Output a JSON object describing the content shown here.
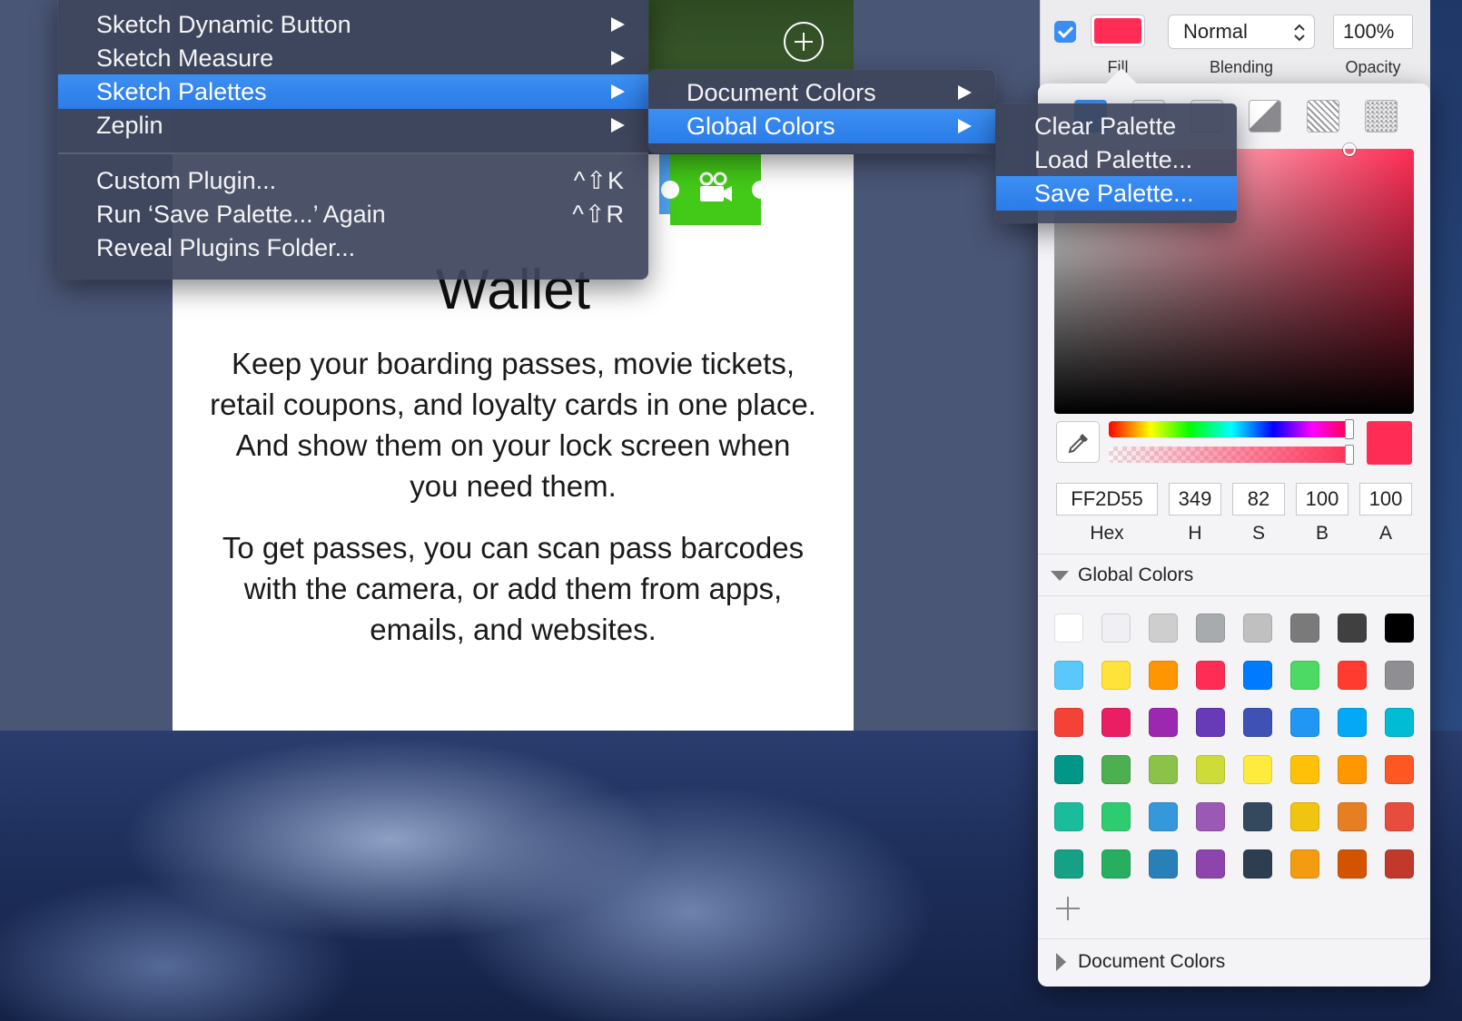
{
  "plugins_menu": {
    "items": [
      {
        "label": "Sketch Dynamic Button",
        "submenu": true
      },
      {
        "label": "Sketch Measure",
        "submenu": true
      },
      {
        "label": "Sketch Palettes",
        "submenu": true,
        "selected": true
      },
      {
        "label": "Zeplin",
        "submenu": true
      }
    ],
    "actions": [
      {
        "label": "Custom Plugin...",
        "shortcut": "^⇧K"
      },
      {
        "label": "Run ‘Save Palette...’ Again",
        "shortcut": "^⇧R"
      },
      {
        "label": "Reveal Plugins Folder...",
        "shortcut": ""
      }
    ]
  },
  "palettes_menu": {
    "items": [
      {
        "label": "Document Colors",
        "submenu": true
      },
      {
        "label": "Global Colors",
        "submenu": true,
        "selected": true
      }
    ]
  },
  "global_colors_menu": {
    "items": [
      {
        "label": "Clear Palette"
      },
      {
        "label": "Load Palette..."
      },
      {
        "label": "Save Palette...",
        "selected": true
      }
    ]
  },
  "artboard": {
    "title": "Wallet",
    "paragraph_1": "Keep your boarding passes, movie tickets, retail coupons, and loyalty cards in one place. And show them on your lock screen when you need them.",
    "paragraph_2": "To get passes, you can scan pass barcodes with the camera, or add them from apps, emails, and websites.",
    "icons": [
      "add-circle-icon",
      "movie-camera-icon"
    ],
    "tile_color": "#43c918"
  },
  "inspector": {
    "fill_label": "Fill",
    "fill_enabled": true,
    "blending_value": "Normal",
    "blending_label": "Blending",
    "opacity_value": "100%",
    "opacity_label": "Opacity"
  },
  "color_picker": {
    "current_color": "#ff2d55",
    "hex_value": "FF2D55",
    "h_value": "349",
    "s_value": "82",
    "b_value": "100",
    "a_value": "100",
    "hex_label": "Hex",
    "h_label": "H",
    "s_label": "S",
    "b_label": "B",
    "a_label": "A",
    "fill_types": [
      "solid-fill-icon",
      "linear-gradient-icon",
      "radial-gradient-icon",
      "angular-gradient-icon",
      "pattern-fill-icon",
      "noise-fill-icon"
    ],
    "global_colors_title": "Global Colors",
    "document_colors_title": "Document Colors",
    "swatches": [
      [
        "#ffffff",
        "#efeff4",
        "#cecece",
        "#a8abad",
        "#c0c0c0",
        "#7a7a7a",
        "#404040",
        "#000000"
      ],
      [
        "#5ac8fa",
        "#ffe23a",
        "#ff9500",
        "#ff2d55",
        "#007aff",
        "#4cd964",
        "#ff3b30",
        "#8e8e93"
      ],
      [
        "#f44336",
        "#e91e63",
        "#9c27b0",
        "#673ab7",
        "#3f51b5",
        "#2196f3",
        "#03a9f4",
        "#00bcd4"
      ],
      [
        "#009688",
        "#4caf50",
        "#8bc34a",
        "#cddc39",
        "#ffeb3b",
        "#ffc107",
        "#ff9800",
        "#ff5722"
      ],
      [
        "#1abc9c",
        "#2ecc71",
        "#3498db",
        "#9b59b6",
        "#34495e",
        "#f1c40f",
        "#e67e22",
        "#e74c3c"
      ],
      [
        "#16a085",
        "#27ae60",
        "#2980b9",
        "#8e44ad",
        "#2c3e50",
        "#f39c12",
        "#d35400",
        "#c0392b"
      ]
    ]
  }
}
